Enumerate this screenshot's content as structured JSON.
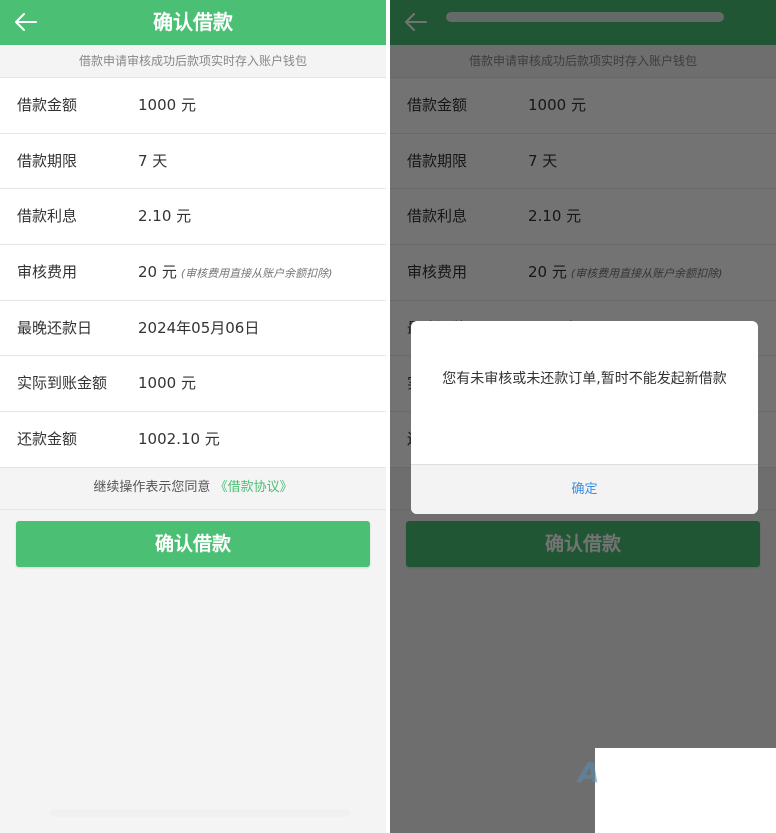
{
  "header": {
    "title": "确认借款"
  },
  "notice": "借款申请审核成功后款项实时存入账户钱包",
  "details": {
    "rows": [
      {
        "label": "借款金额",
        "value": "1000 元",
        "note": ""
      },
      {
        "label": "借款期限",
        "value": "7 天",
        "note": ""
      },
      {
        "label": "借款利息",
        "value": "2.10 元",
        "note": ""
      },
      {
        "label": "审核费用",
        "value": "20 元",
        "note": "(审核费用直接从账户余额扣除)"
      },
      {
        "label": "最晚还款日",
        "value": "2024年05月06日",
        "note": ""
      },
      {
        "label": "实际到账金额",
        "value": "1000 元",
        "note": ""
      },
      {
        "label": "还款金额",
        "value": "1002.10 元",
        "note": ""
      }
    ]
  },
  "agreement": {
    "text": "继续操作表示您同意",
    "link": "《借款协议》"
  },
  "confirm_button": "确认借款",
  "dialog": {
    "message": "您有未审核或未还款订单,暂时不能发起新借款",
    "ok_label": "确定"
  },
  "watermark": "A",
  "colors": {
    "brand_green": "#4bbf73",
    "dialog_button": "#3b8fe0",
    "overlay": "rgba(0,0,0,0.55)"
  },
  "icons": {
    "back": "arrow-left-icon"
  }
}
